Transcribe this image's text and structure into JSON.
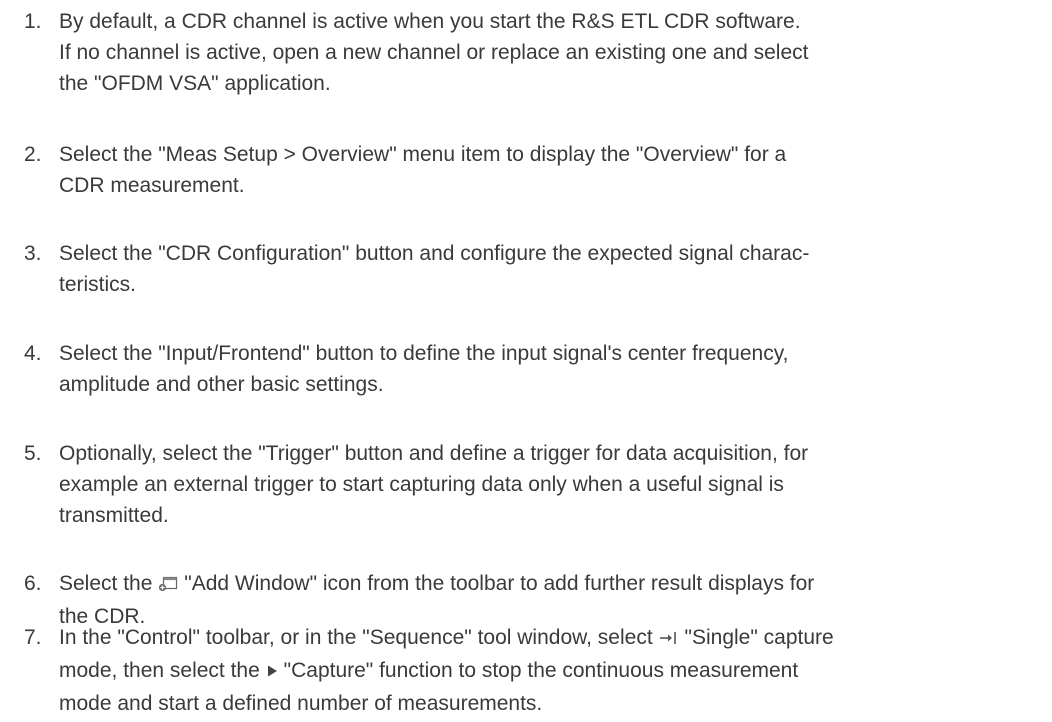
{
  "steps": [
    {
      "number": "1.",
      "lines": [
        "By default, a CDR channel is active when you start the R&S ETL CDR software.",
        "If no channel is active, open a new channel or replace an existing one and select",
        "the \"OFDM VSA\" application."
      ]
    },
    {
      "number": "2.",
      "lines": [
        "Select the \"Meas Setup > Overview\" menu item to display the \"Overview\" for a",
        "CDR measurement."
      ]
    },
    {
      "number": "3.",
      "lines": [
        "Select the \"CDR Configuration\" button and configure the expected signal charac-",
        "teristics."
      ]
    },
    {
      "number": "4.",
      "lines": [
        "Select the \"Input/Frontend\" button to define the input signal's center frequency,",
        "amplitude and other basic settings."
      ]
    },
    {
      "number": "5.",
      "lines": [
        "Optionally, select the \"Trigger\" button and define a trigger for data acquisition, for",
        "example an external trigger to start capturing data only when a useful signal is",
        "transmitted."
      ]
    },
    {
      "number": "6.",
      "line1_pre": "Select the",
      "icon_name": "add-window-icon",
      "line1_post": "\"Add Window\" icon from the toolbar to add further result displays for",
      "line2": "the CDR."
    },
    {
      "number": "7.",
      "line1_pre": "In the \"Control\" toolbar, or in the \"Sequence\" tool window, select",
      "icon1_name": "single-capture-icon",
      "line1_post": "\"Single\" capture",
      "line2_pre": "mode, then select the",
      "icon2_name": "capture-play-icon",
      "line2_post": "\"Capture\" function to stop the continuous measurement",
      "line3": "mode and start a defined number of measurements."
    }
  ],
  "colors": {
    "text": "#3a3a3a",
    "icon": "#555555"
  }
}
